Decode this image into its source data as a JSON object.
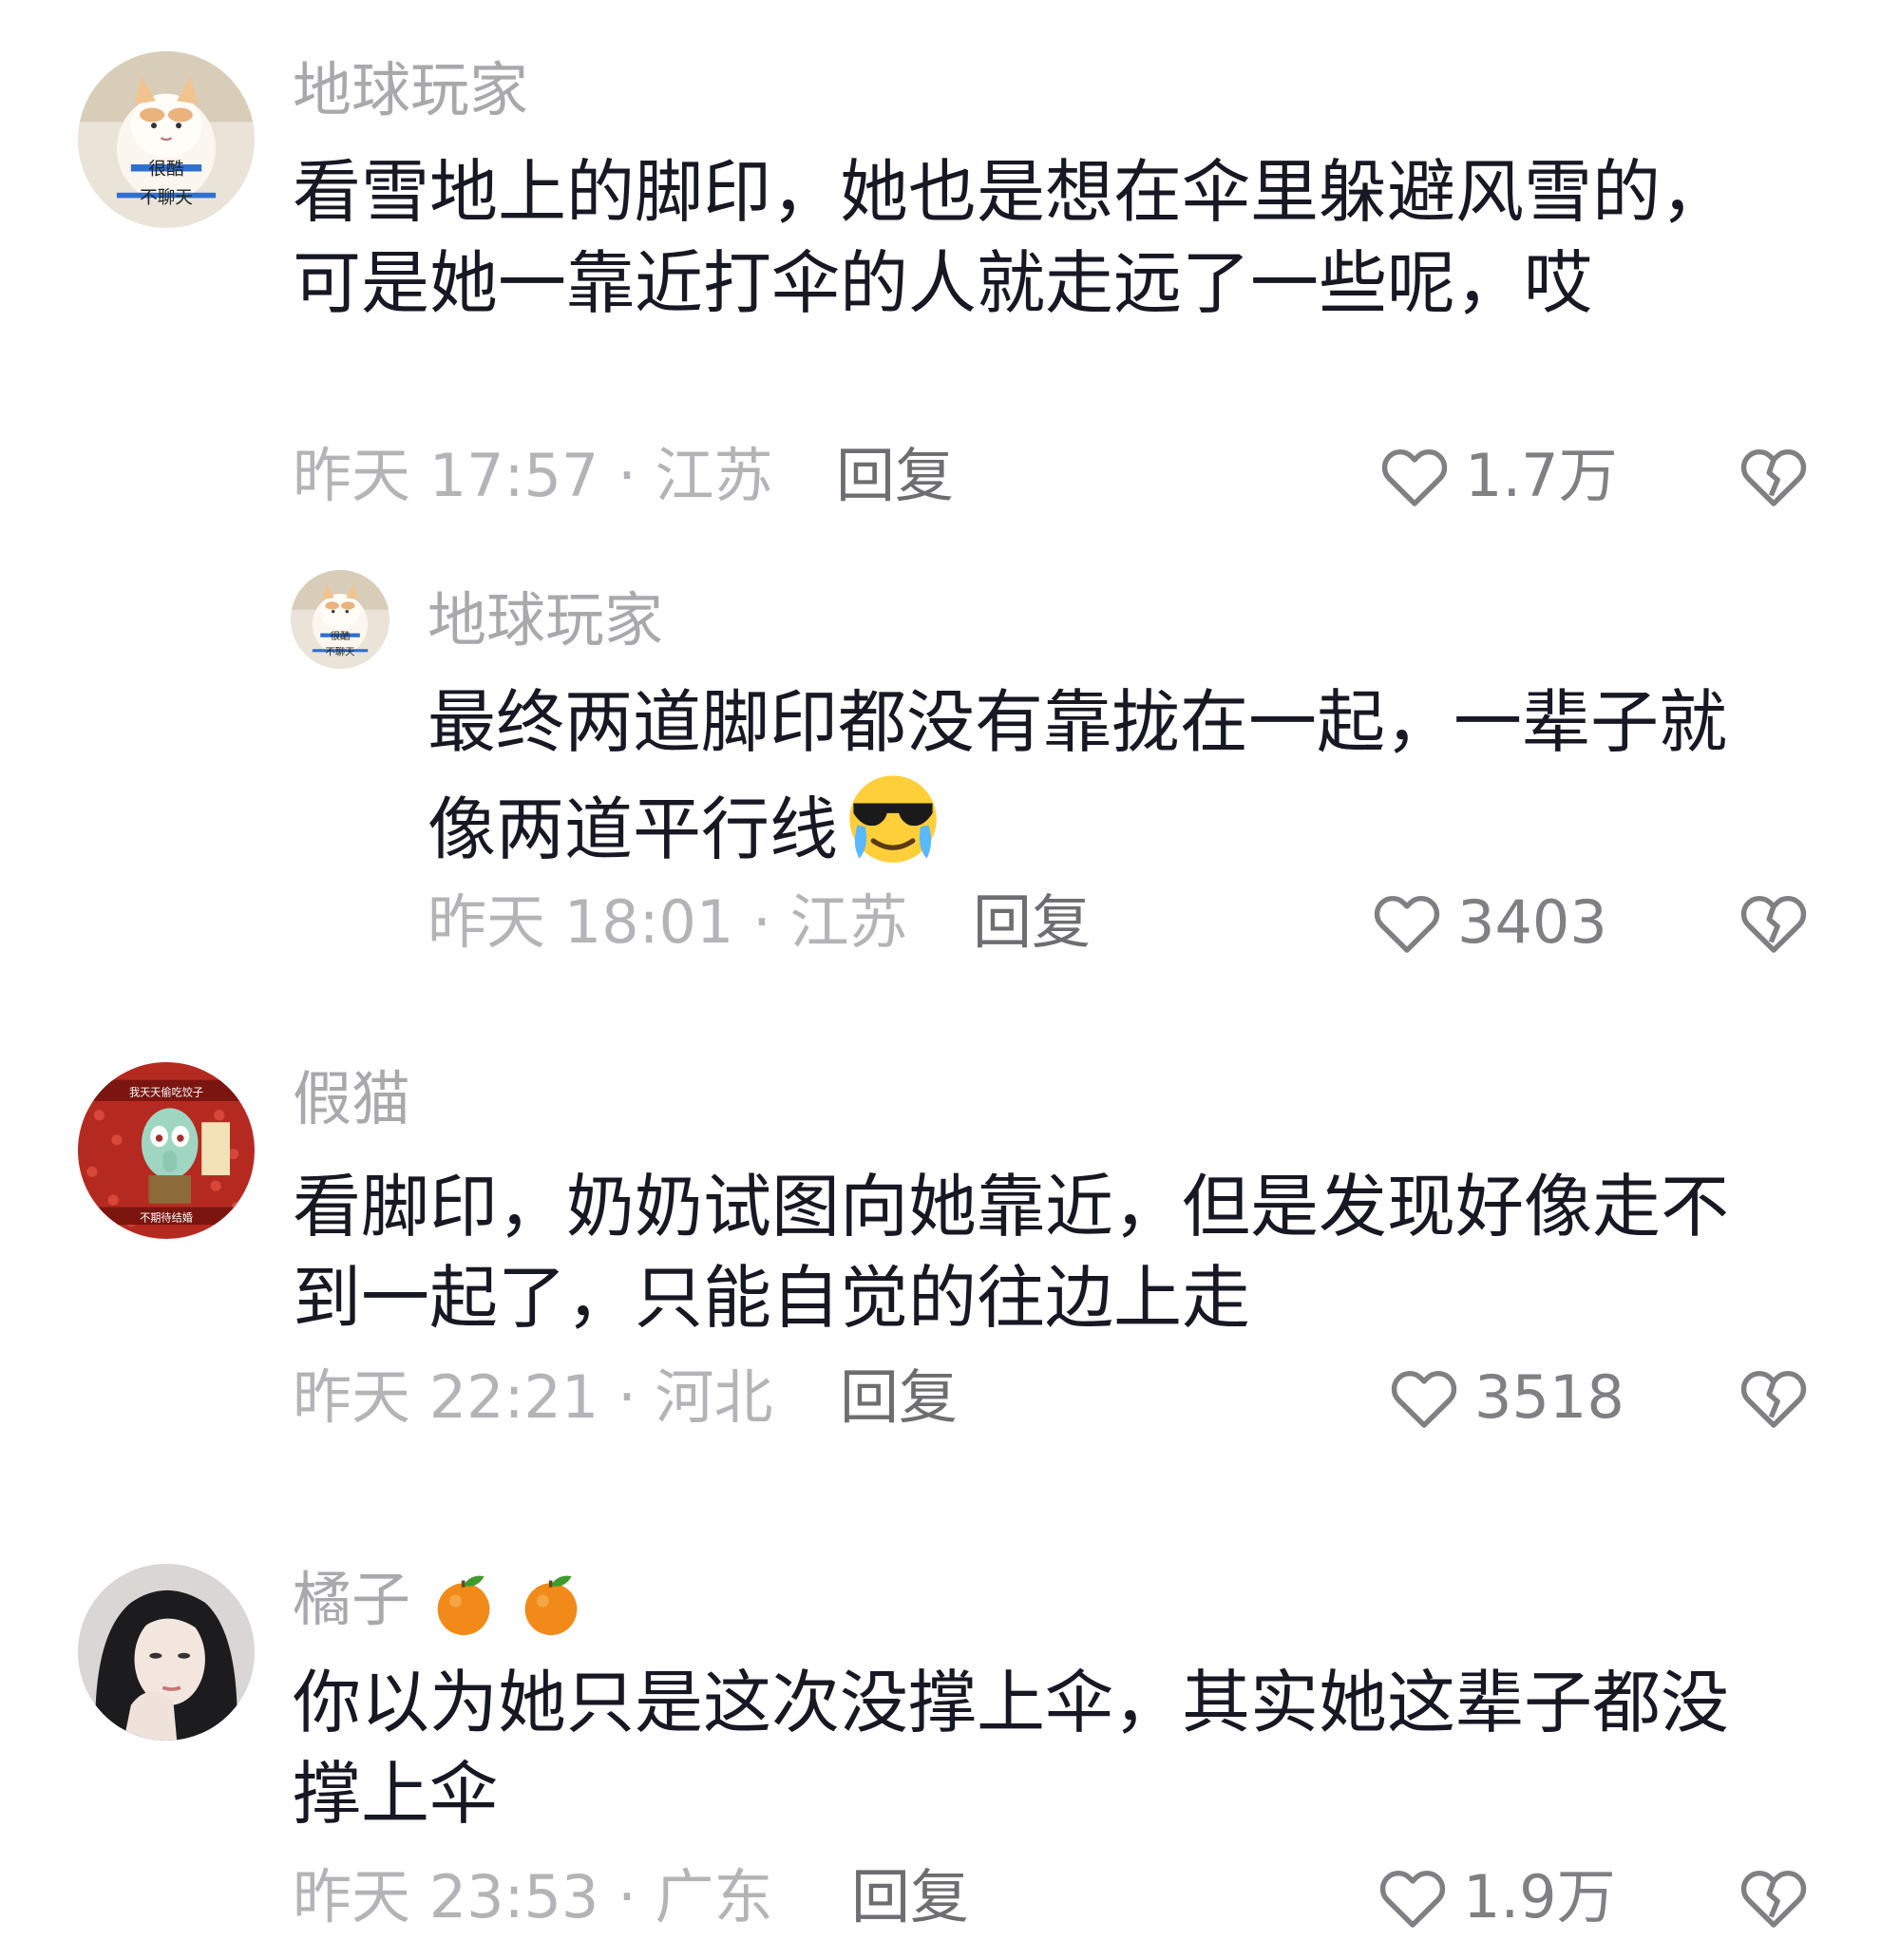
{
  "comments": [
    {
      "username": "地球玩家",
      "avatar_caption": [
        "很酷",
        "不聊天"
      ],
      "text": "看雪地上的脚印，她也是想在伞里躲避风雪的，可是她一靠近打伞的人就走远了一些呢，哎",
      "meta": "昨天 17:57 · 江苏",
      "reply_label": "回复",
      "likes": "1.7万",
      "replies": [
        {
          "username": "地球玩家",
          "avatar_caption": [
            "很酷",
            "不聊天"
          ],
          "text": "最终两道脚印都没有靠拢在一起，一辈子就像两道平行线",
          "meta": "昨天 18:01 · 江苏",
          "reply_label": "回复",
          "likes": "3403"
        }
      ]
    },
    {
      "username": "假猫",
      "avatar_caption": [
        "我天天偷吃饺子",
        "不期待结婚"
      ],
      "text": "看脚印，奶奶试图向她靠近，但是发现好像走不到一起了，只能自觉的往边上走",
      "meta": "昨天 22:21 · 河北",
      "reply_label": "回复",
      "likes": "3518"
    },
    {
      "username": "橘子",
      "text": "你以为她只是这次没撑上伞，其实她这辈子都没撑上伞",
      "meta": "昨天 23:53 · 广东",
      "reply_label": "回复",
      "likes": "1.9万"
    }
  ],
  "icons": {
    "like": "heart-outline-icon",
    "dislike": "broken-heart-icon",
    "username_emoji": "tangerine-icon",
    "reply_emoji": "cool-crying-face-icon"
  },
  "colors": {
    "text": "#161823",
    "username": "#a8a8ad",
    "meta": "#b4b4b8",
    "reply": "#6d6d72",
    "like_count": "#7f7f84"
  }
}
